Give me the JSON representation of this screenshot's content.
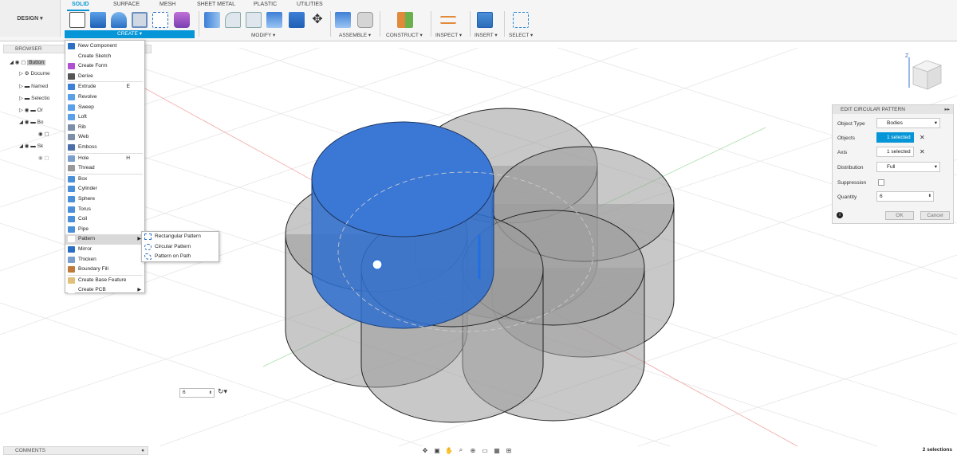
{
  "design_button": "DESIGN",
  "tabs": [
    "SOLID",
    "SURFACE",
    "MESH",
    "SHEET METAL",
    "PLASTIC",
    "UTILITIES"
  ],
  "groups": {
    "create": "CREATE",
    "modify": "MODIFY",
    "assemble": "ASSEMBLE",
    "construct": "CONSTRUCT",
    "inspect": "INSPECT",
    "insert": "INSERT",
    "select": "SELECT"
  },
  "browser": {
    "title": "BROWSER",
    "rows": [
      "Button",
      "Docume",
      "Named",
      "Selectio",
      "Or",
      "Bo",
      "Sk"
    ]
  },
  "create_menu": {
    "items": [
      {
        "label": "New Component"
      },
      {
        "label": "Create Sketch"
      },
      {
        "label": "Create Form"
      },
      {
        "label": "Derive"
      },
      {
        "label": "Extrude",
        "shortcut": "E"
      },
      {
        "label": "Revolve"
      },
      {
        "label": "Sweep"
      },
      {
        "label": "Loft"
      },
      {
        "label": "Rib"
      },
      {
        "label": "Web"
      },
      {
        "label": "Emboss"
      },
      {
        "label": "Hole",
        "shortcut": "H"
      },
      {
        "label": "Thread"
      },
      {
        "label": "Box"
      },
      {
        "label": "Cylinder"
      },
      {
        "label": "Sphere"
      },
      {
        "label": "Torus"
      },
      {
        "label": "Coil"
      },
      {
        "label": "Pipe"
      },
      {
        "label": "Pattern"
      },
      {
        "label": "Mirror"
      },
      {
        "label": "Thicken"
      },
      {
        "label": "Boundary Fill"
      },
      {
        "label": "Create Base Feature"
      },
      {
        "label": "Create PCB"
      }
    ]
  },
  "pattern_submenu": [
    "Rectangular Pattern",
    "Circular Pattern",
    "Pattern on Path"
  ],
  "panel": {
    "title": "EDIT CIRCULAR PATTERN",
    "object_type_label": "Object Type",
    "object_type_value": "Bodies",
    "objects_label": "Objects",
    "objects_value": "1 selected",
    "axis_label": "Axis",
    "axis_value": "1 selected",
    "distribution_label": "Distribution",
    "distribution_value": "Full",
    "suppression_label": "Suppression",
    "quantity_label": "Quantity",
    "quantity_value": "6",
    "ok": "OK",
    "cancel": "Cancel"
  },
  "floating_quantity": "6",
  "comments": "COMMENTS",
  "status": "2 selections",
  "colors": {
    "accent": "#0696d7",
    "selected_body": "#2f6fcf",
    "body": "#a9a9a9"
  }
}
